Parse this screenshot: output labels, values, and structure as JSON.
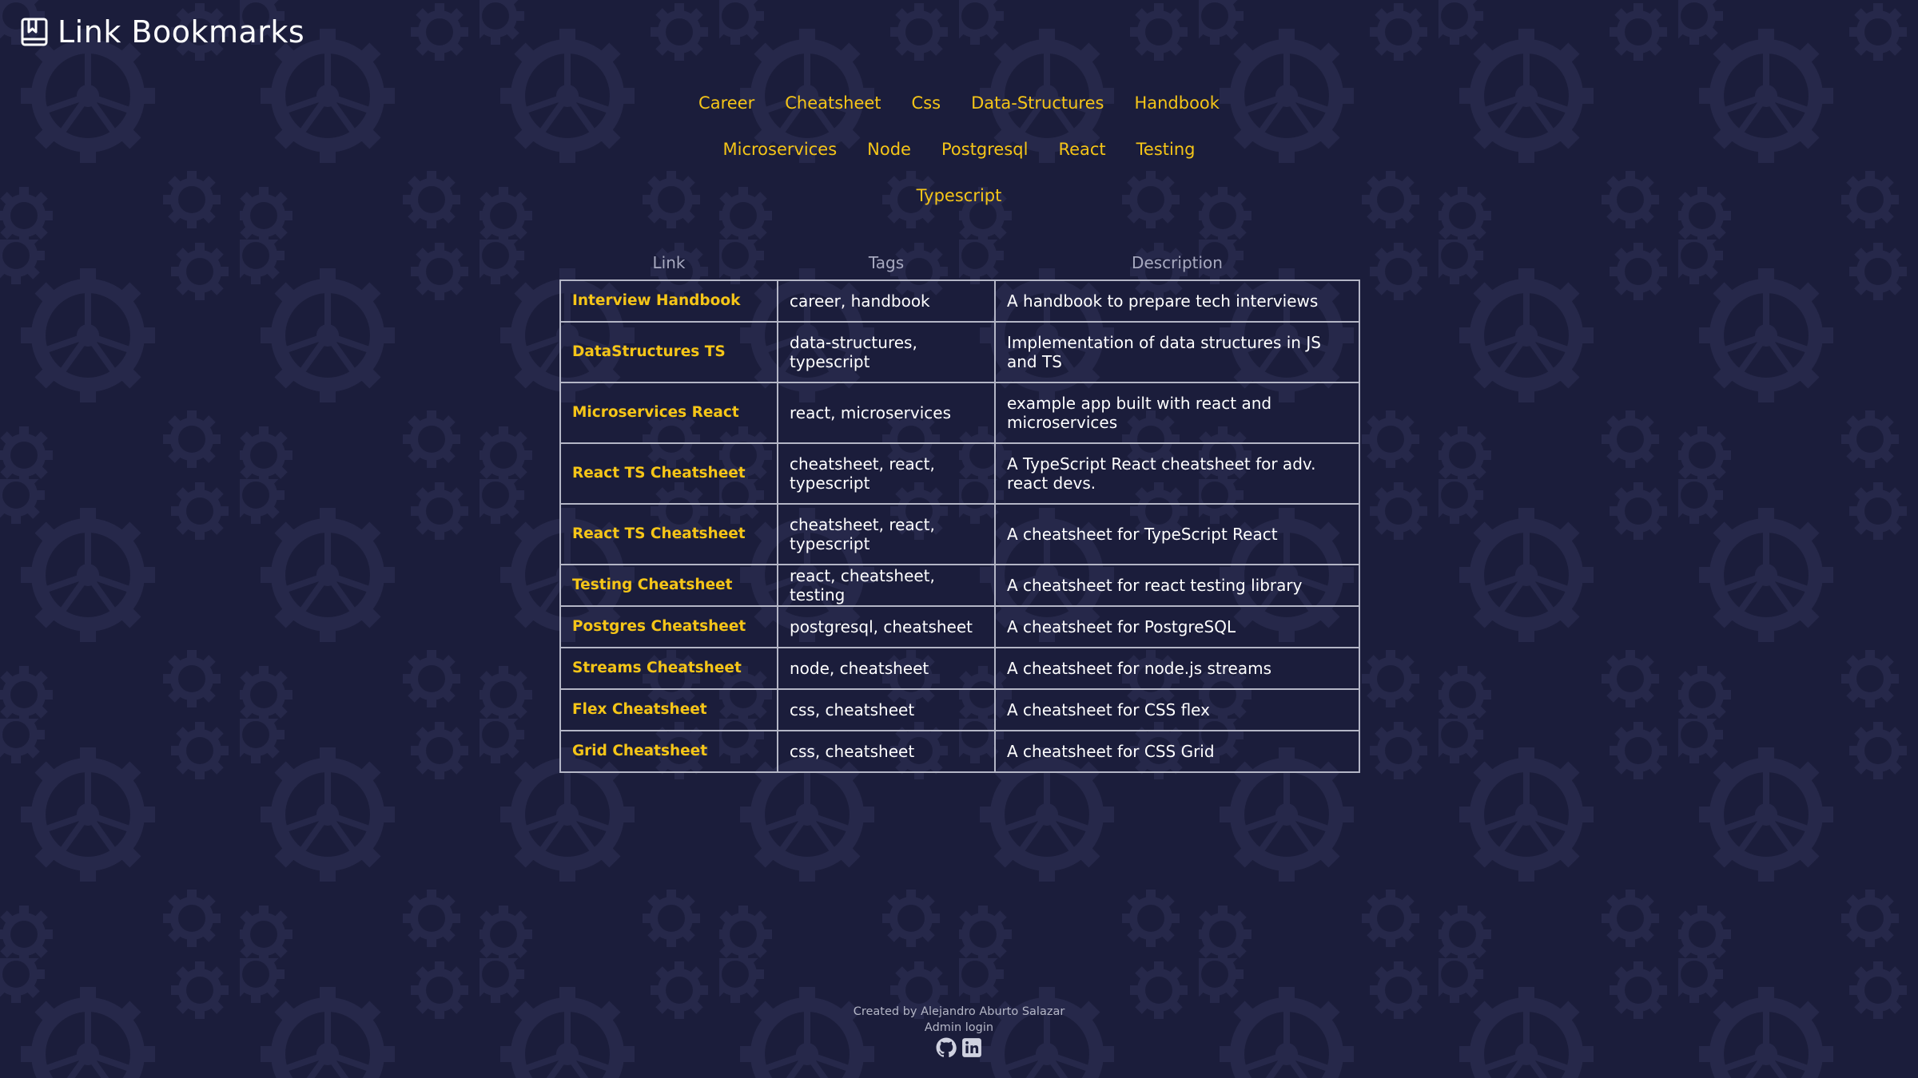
{
  "header": {
    "title": "Link Bookmarks",
    "icon": "bookmark-book-icon"
  },
  "tags": {
    "rows": [
      [
        "Career",
        "Cheatsheet",
        "Css",
        "Data-Structures",
        "Handbook"
      ],
      [
        "Microservices",
        "Node",
        "Postgresql",
        "React",
        "Testing"
      ],
      [
        "Typescript"
      ]
    ]
  },
  "table": {
    "headers": {
      "link": "Link",
      "tags": "Tags",
      "description": "Description"
    },
    "rows": [
      {
        "link": "Interview Handbook",
        "tags": "career, handbook",
        "description": "A handbook to prepare tech interviews"
      },
      {
        "link": "DataStructures TS",
        "tags": "data-structures, typescript",
        "description": "Implementation of data structures in JS and TS"
      },
      {
        "link": "Microservices React",
        "tags": "react, microservices",
        "description": "example app built with react and microservices"
      },
      {
        "link": "React TS Cheatsheet",
        "tags": "cheatsheet, react, typescript",
        "description": "A TypeScript React cheatsheet for adv. react devs."
      },
      {
        "link": "React TS Cheatsheet",
        "tags": "cheatsheet, react, typescript",
        "description": "A cheatsheet for TypeScript React"
      },
      {
        "link": "Testing Cheatsheet",
        "tags": "react, cheatsheet, testing",
        "description": "A cheatsheet for react testing library"
      },
      {
        "link": "Postgres Cheatsheet",
        "tags": "postgresql, cheatsheet",
        "description": "A cheatsheet for PostgreSQL"
      },
      {
        "link": "Streams Cheatsheet",
        "tags": "node, cheatsheet",
        "description": "A cheatsheet for node.js streams"
      },
      {
        "link": "Flex Cheatsheet",
        "tags": "css, cheatsheet",
        "description": "A cheatsheet for CSS flex"
      },
      {
        "link": "Grid Cheatsheet",
        "tags": "css, cheatsheet",
        "description": "A cheatsheet for CSS Grid"
      }
    ]
  },
  "footer": {
    "credit": "Created by Alejandro Aburto Salazar",
    "admin": "Admin login",
    "icons": [
      "github-icon",
      "linkedin-icon"
    ]
  },
  "colors": {
    "background": "#1b1d3b",
    "accent": "#f5c518",
    "gear": "#2a2c4d"
  }
}
